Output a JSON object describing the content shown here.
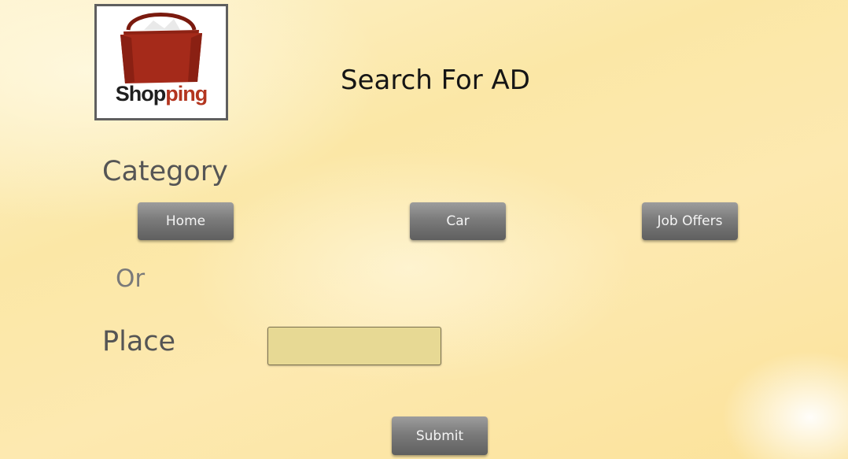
{
  "header": {
    "logo": {
      "text_dark": "Shop",
      "text_accent": "ping",
      "icon": "shopping-bag-icon",
      "bag_color": "#a52a1a",
      "accent_color": "#b3351f"
    },
    "title": "Search For AD"
  },
  "category": {
    "label": "Category",
    "options": [
      {
        "label": "Home"
      },
      {
        "label": "Car"
      },
      {
        "label": "Job Offers"
      }
    ]
  },
  "separator": "Or",
  "place": {
    "label": "Place",
    "value": "",
    "placeholder": ""
  },
  "form": {
    "submit_label": "Submit"
  },
  "colors": {
    "button": "#7b7b7b",
    "input_fill": "#e7d994",
    "background": "#fbe7a6"
  }
}
